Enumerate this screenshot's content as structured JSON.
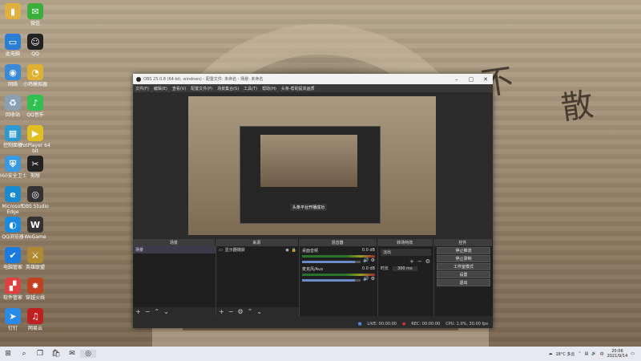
{
  "desktop": {
    "icons": [
      {
        "label": "",
        "icon": "folder-icon",
        "color": "#e0b040",
        "glyph": "▮"
      },
      {
        "label": "此电脑",
        "icon": "computer-icon",
        "color": "#2a7fd4",
        "glyph": "▭"
      },
      {
        "label": "网络",
        "icon": "network-icon",
        "color": "#3a8ad8",
        "glyph": "◉"
      },
      {
        "label": "回收站",
        "icon": "recycle-bin-icon",
        "color": "#8aa0b0",
        "glyph": "♻"
      },
      {
        "label": "控制面板",
        "icon": "control-panel-icon",
        "color": "#2a9ad0",
        "glyph": "▦"
      },
      {
        "label": "360安全卫士",
        "icon": "security-icon",
        "color": "#3a9ae0",
        "glyph": "⛨"
      },
      {
        "label": "Microsoft Edge",
        "icon": "edge-icon",
        "color": "#1a8ad0",
        "glyph": "e"
      },
      {
        "label": "QQ浏览器",
        "icon": "qq-browser-icon",
        "color": "#1a8ae0",
        "glyph": "◐"
      },
      {
        "label": "电脑管家",
        "icon": "pc-manager-icon",
        "color": "#1a7ae0",
        "glyph": "✔"
      },
      {
        "label": "软件管家",
        "icon": "software-manager-icon",
        "color": "#e04040",
        "glyph": "▞"
      },
      {
        "label": "钉钉",
        "icon": "dingtalk-icon",
        "color": "#2a8ae8",
        "glyph": "➤"
      },
      {
        "label": "微信",
        "icon": "wechat-icon",
        "color": "#3ab03a",
        "glyph": "✉"
      },
      {
        "label": "QQ",
        "icon": "qq-icon",
        "color": "#222222",
        "glyph": "☺"
      },
      {
        "label": "小鸡模拟器",
        "icon": "emulator-icon",
        "color": "#e0b030",
        "glyph": "◔"
      },
      {
        "label": "QQ音乐",
        "icon": "qq-music-icon",
        "color": "#30c050",
        "glyph": "♪"
      },
      {
        "label": "PotPlayer 64 bit",
        "icon": "potplayer-icon",
        "color": "#e0c020",
        "glyph": "▶"
      },
      {
        "label": "剪映",
        "icon": "jianying-icon",
        "color": "#222222",
        "glyph": "✂"
      },
      {
        "label": "OBS Studio",
        "icon": "obs-icon",
        "color": "#333333",
        "glyph": "◎"
      },
      {
        "label": "WeGame",
        "icon": "wegame-icon",
        "color": "#333333",
        "glyph": "W"
      },
      {
        "label": "英雄联盟",
        "icon": "lol-icon",
        "color": "#b08a30",
        "glyph": "⚔"
      },
      {
        "label": "穿越火线",
        "icon": "crossfire-icon",
        "color": "#c04020",
        "glyph": "✸"
      },
      {
        "label": "网易云",
        "icon": "netease-icon",
        "color": "#c02020",
        "glyph": "♫"
      }
    ]
  },
  "obs": {
    "title": "OBS 25.0.8 (64-bit, windows) - 配置文件: 未命名 - 场景: 未命名",
    "menu": [
      "文件(F)",
      "编辑(E)",
      "查看(V)",
      "配置文件(P)",
      "场景集合(S)",
      "工具(T)",
      "帮助(H)",
      "头条-帮助提高画质"
    ],
    "docks": {
      "scenes": "场景",
      "sources": "来源",
      "mixer": "混音器",
      "transitions": "转场特效",
      "controls": "控件"
    },
    "scene_items": [
      "场景"
    ],
    "source_items": [
      "显示器捕获"
    ],
    "mixer_tracks": [
      {
        "name": "桌面音频",
        "db": "0.0 dB",
        "level": 0.9
      },
      {
        "name": "麦克风/Aux",
        "db": "0.0 dB",
        "level": 0.9
      }
    ],
    "transition": {
      "type": "淡出",
      "duration_label": "时长",
      "duration": "300 ms"
    },
    "controls": [
      "停止推流",
      "停止录制",
      "工作室模式",
      "设置",
      "退出"
    ],
    "nested_toast": "头条平台开播成功",
    "status": {
      "live": "LIVE: 00:00:00",
      "rec": "REC: 00:00:00",
      "cpu": "CPU: 1.0%, 30.00 fps"
    }
  },
  "taskbar": {
    "weather": "18°C 多云",
    "time": "20:06",
    "date": "2021/9/14"
  }
}
